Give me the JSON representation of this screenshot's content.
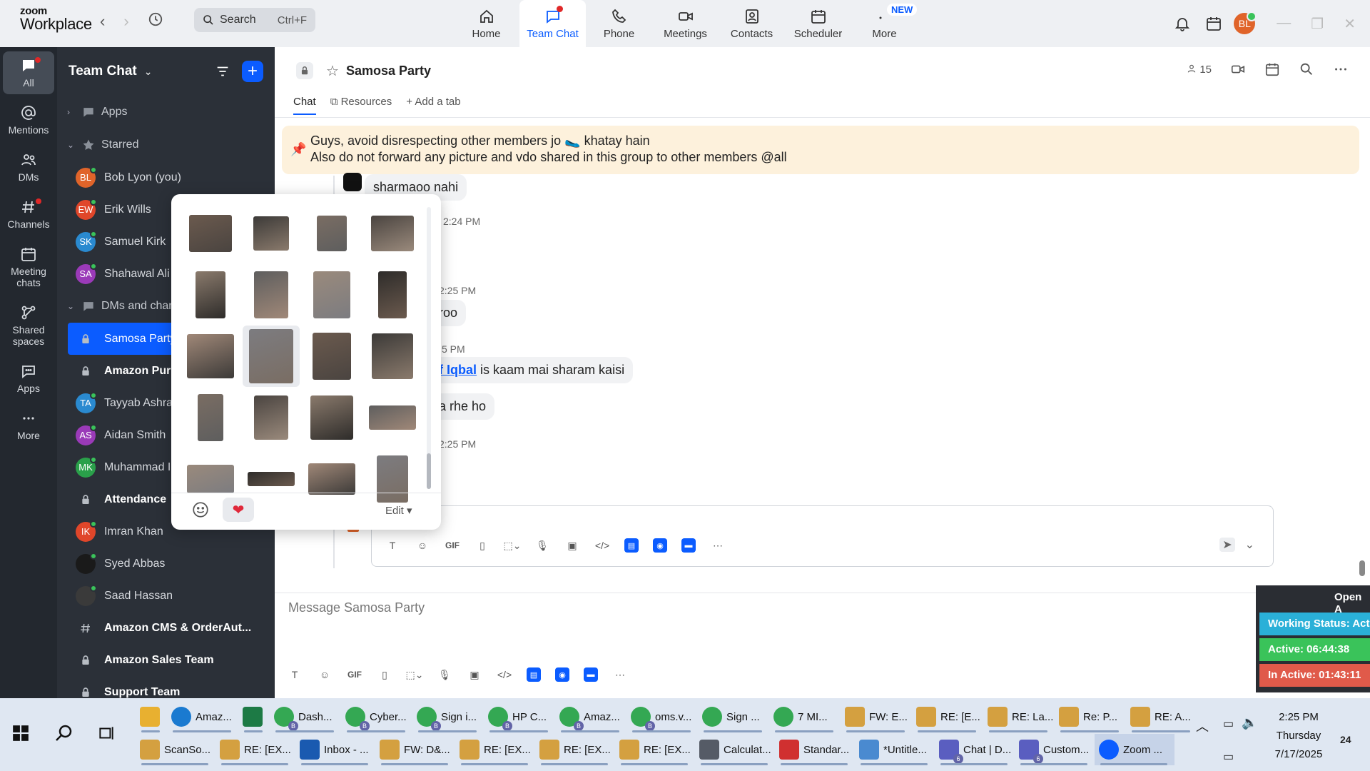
{
  "app": {
    "logo_top": "zoom",
    "logo_bottom": "Workplace"
  },
  "search": {
    "label": "Search",
    "shortcut": "Ctrl+F"
  },
  "topnav": [
    {
      "label": "Home",
      "icon": "home-icon"
    },
    {
      "label": "Team Chat",
      "icon": "chat-icon",
      "active": true
    },
    {
      "label": "Phone",
      "icon": "phone-icon"
    },
    {
      "label": "Meetings",
      "icon": "video-icon"
    },
    {
      "label": "Contacts",
      "icon": "contacts-icon"
    },
    {
      "label": "Scheduler",
      "icon": "scheduler-icon"
    },
    {
      "label": "More",
      "icon": "more-icon",
      "badge": "NEW"
    }
  ],
  "user_avatar": "BL",
  "rail": [
    {
      "label": "All",
      "active": true
    },
    {
      "label": "Mentions"
    },
    {
      "label": "DMs"
    },
    {
      "label": "Channels"
    },
    {
      "label": "Meeting chats"
    },
    {
      "label": "Shared spaces"
    },
    {
      "label": "Apps"
    },
    {
      "label": "More"
    }
  ],
  "sidebar": {
    "title": "Team Chat",
    "sections": {
      "apps": "Apps",
      "starred": "Starred",
      "dms": "DMs and chann"
    },
    "starred": [
      {
        "label": "Bob Lyon (you)",
        "initials": "BL",
        "color": "#e0642a"
      },
      {
        "label": "Erik Wills",
        "initials": "EW",
        "color": "#e0462a"
      },
      {
        "label": "Samuel Kirk",
        "initials": "SK",
        "color": "#2a8ad0"
      },
      {
        "label": "Shahawal Ali",
        "initials": "SA",
        "color": "#9a3ab8"
      }
    ],
    "items": [
      {
        "label": "Samosa Party",
        "type": "lock",
        "selected": true
      },
      {
        "label": "Amazon Pur",
        "type": "lock",
        "bold": true
      },
      {
        "label": "Tayyab Ashra",
        "initials": "TA",
        "color": "#2a8ad0"
      },
      {
        "label": "Aidan Smith",
        "initials": "AS",
        "color": "#9a3ab8"
      },
      {
        "label": "Muhammad I",
        "initials": "MK",
        "color": "#2aa04a"
      },
      {
        "label": "Attendance",
        "type": "lock",
        "bold": true
      },
      {
        "label": "Imran Khan",
        "initials": "IK",
        "color": "#e0462a"
      },
      {
        "label": "Syed Abbas",
        "initials": "",
        "color": "#1a1a1a"
      },
      {
        "label": "Saad Hassan",
        "initials": "",
        "color": "#3a3a3a"
      },
      {
        "label": "Amazon CMS & OrderAut...",
        "type": "hash",
        "bold": true
      },
      {
        "label": "Amazon Sales Team",
        "type": "lock",
        "bold": true
      },
      {
        "label": "Support Team",
        "type": "lock",
        "bold": true
      }
    ]
  },
  "channel": {
    "title": "Samosa Party",
    "members": "15",
    "tabs": {
      "chat": "Chat",
      "resources": "Resources",
      "add": "Add a tab"
    },
    "pinned_line1": "Guys, avoid disrespecting other members jo 🥿 khatay hain",
    "pinned_line2": "Also do not forward any picture and vdo shared in this group to other members @all"
  },
  "messages": {
    "m1": "sharmaoo nahi",
    "t1": "2:24 PM",
    "t2": "2:25 PM",
    "m2": "aroo",
    "t3": "5 PM",
    "m3_mention": "af Iqbal",
    "m3_rest": " is kaam mai sharam kaisi",
    "m4": "na rhe ho",
    "t4": "2:25 PM"
  },
  "popup": {
    "edit_label": "Edit"
  },
  "compose": {
    "placeholder": "Message Samosa Party"
  },
  "widget": {
    "header": "Open A",
    "status": "Working Status: Acti",
    "active": "Active: 06:44:38",
    "inactive": "In Active: 01:43:11"
  },
  "taskbar": {
    "row1": [
      {
        "label": "",
        "color": "#e8b030",
        "sq": true
      },
      {
        "label": "Amaz...",
        "color": "#1a7ad0"
      },
      {
        "label": "",
        "color": "#1d7a45",
        "sq": true
      },
      {
        "label": "Dash...",
        "color": "#34a853",
        "badge": "B"
      },
      {
        "label": "Cyber...",
        "color": "#34a853",
        "badge": "B"
      },
      {
        "label": "Sign i...",
        "color": "#34a853",
        "badge": "B"
      },
      {
        "label": "HP C...",
        "color": "#34a853",
        "badge": "B"
      },
      {
        "label": "Amaz...",
        "color": "#34a853",
        "badge": "B"
      },
      {
        "label": "oms.v...",
        "color": "#34a853",
        "badge": "B"
      },
      {
        "label": "Sign ...",
        "color": "#34a853"
      },
      {
        "label": "7 MI...",
        "color": "#34a853"
      },
      {
        "label": "FW: E...",
        "color": "#d4a040",
        "sq": true
      },
      {
        "label": "RE: [E...",
        "color": "#d4a040",
        "sq": true
      },
      {
        "label": "RE: La...",
        "color": "#d4a040",
        "sq": true
      },
      {
        "label": "Re: P...",
        "color": "#d4a040",
        "sq": true
      },
      {
        "label": "RE: A...",
        "color": "#d4a040",
        "sq": true
      }
    ],
    "row2": [
      {
        "label": "ScanSo...",
        "color": "#d4a040",
        "sq": true
      },
      {
        "label": "RE: [EX...",
        "color": "#d4a040",
        "sq": true
      },
      {
        "label": "Inbox - ...",
        "color": "#1a5ab0",
        "sq": true
      },
      {
        "label": "FW: D&...",
        "color": "#d4a040",
        "sq": true
      },
      {
        "label": "RE: [EX...",
        "color": "#d4a040",
        "sq": true
      },
      {
        "label": "RE: [EX...",
        "color": "#d4a040",
        "sq": true
      },
      {
        "label": "RE: [EX...",
        "color": "#d4a040",
        "sq": true
      },
      {
        "label": "Calculat...",
        "color": "#555b66",
        "sq": true
      },
      {
        "label": "Standar...",
        "color": "#d03030",
        "sq": true
      },
      {
        "label": "*Untitle...",
        "color": "#4a8ad0",
        "sq": true
      },
      {
        "label": "Chat | D...",
        "color": "#5a5ec0",
        "sq": true,
        "badge": "6"
      },
      {
        "label": "Custom...",
        "color": "#5a5ec0",
        "sq": true,
        "badge": "6"
      },
      {
        "label": "Zoom ...",
        "color": "#0b5cff",
        "active": true
      }
    ]
  },
  "clock": {
    "time": "2:25 PM",
    "day": "Thursday",
    "date": "7/17/2025",
    "notif": "24"
  }
}
